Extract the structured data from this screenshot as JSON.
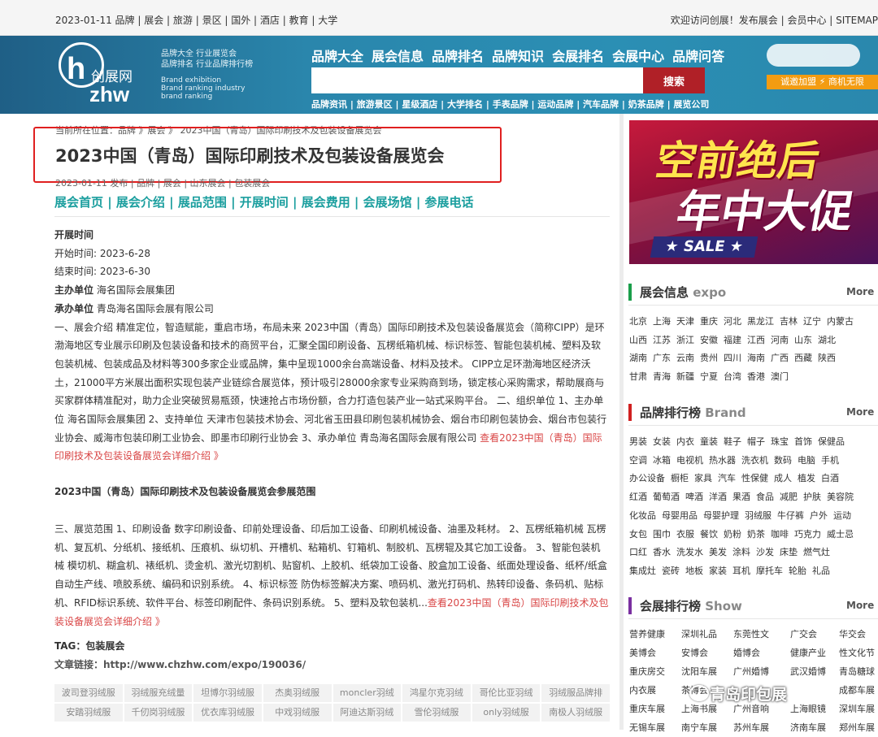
{
  "topbar": {
    "left": "2023-01-11 品牌 | 展会 | 旅游 | 景区 | 国外 | 酒店 | 教育 | 大学",
    "right": "欢迎访问创展！发布展会 | 会员中心 | SITEMAP"
  },
  "header": {
    "logo_cn": "创展网",
    "logo_h": "h",
    "logo_en": "zhw",
    "slogan_1": "品牌大全 行业展览会",
    "slogan_2": "品牌排名 行业品牌排行榜",
    "slogan_en_1": "Brand exhibition",
    "slogan_en_2": "Brand ranking industry",
    "slogan_en_3": "brand ranking",
    "nav": [
      "品牌大全",
      "展会信息",
      "品牌排名",
      "品牌知识",
      "会展排名",
      "会展中心",
      "品牌问答"
    ],
    "search_placeholder": "",
    "search_button": "搜索",
    "subnav": "品牌资讯 | 旅游景区 | 星级酒店 | 大学排名 | 手表品牌 | 运动品牌 | 汽车品牌 | 奶茶品牌 | 展览公司",
    "chip": "诚邀加盟 ⚡ 商机无限"
  },
  "article": {
    "breadcrumb": "当前所在位置：品牌 》展会 》 2023中国（青岛）国际印刷技术及包装设备展览会",
    "title": "2023中国（青岛）国际印刷技术及包装设备展览会",
    "meta": "2023-01-11 发布 | 品牌 | 展会 | 山东展会 | 包装展会",
    "nav": "展会首页 | 展会介绍 | 展品范围 | 开展时间 | 展会费用 | 会展场馆 | 参展电话",
    "time_heading": "开展时间",
    "start": "开始时间: 2023-6-28",
    "end": "结束时间: 2023-6-30",
    "organizer_label": "主办单位",
    "organizer": "海名国际会展集团",
    "undertaker_label": "承办单位",
    "undertaker": "青岛海名国际会展有限公司",
    "intro_1": "一、展会介绍 精准定位，智造赋能，重启市场，布局未来 2023中国（青岛）国际印刷技术及包装设备展览会（简称CIPP）是环渤海地区专业展示印刷及包装设备和技术的商贸平台，汇聚全国印刷设备、瓦楞纸箱机械、标识标签、智能包装机械、塑料及软包装机械、包装成品及材料等300多家企业或品牌，集中呈现1000余台高端设备、材料及技术。 CIPP立足环渤海地区经济沃土，21000平方米展出面积实现包装产业链综合展览体，预计吸引28000余家专业采购商到场，锁定核心采购需求，帮助展商与买家群体精准配对，助力企业突破贸易瓶颈，快速抢占市场份额，合力打造包装产业一站式采购平台。 二、组织单位 1、主办单位 海名国际会展集团 2、支持单位 天津市包装技术协会、河北省玉田县印刷包装机械协会、烟台市印刷包装协会、烟台市包装行业协会、威海市包装印刷工业协会、即墨市印刷行业协会 3、承办单位 青岛海名国际会展有限公司 ",
    "intro_link": "查看2023中国（青岛）国际印刷技术及包装设备展览会详细介绍 》",
    "scope_title": "2023中国（青岛）国际印刷技术及包装设备展览会参展范围",
    "scope_text": "三、展览范围 1、印刷设备 数字印刷设备、印前处理设备、印后加工设备、印刷机械设备、油墨及耗材。 2、瓦楞纸箱机械 瓦楞机、复瓦机、分纸机、接纸机、压痕机、纵切机、开槽机、粘箱机、钉箱机、制胶机、瓦楞辊及其它加工设备。 3、智能包装机械 模切机、糊盒机、裱纸机、烫金机、激光切割机、贴窗机、上胶机、纸袋加工设备、胶盒加工设备、纸面处理设备、纸杯/纸盒自动生产线、喷胶系统、编码和识别系统。 4、标识标签 防伪标签解决方案、喷码机、激光打码机、热转印设备、条码机、贴标机、RFID标识系统、软件平台、标签印刷配件、条码识别系统。 5、塑料及软包装机...",
    "scope_link": "查看2023中国（青岛）国际印刷技术及包装设备展览会详细介绍 》",
    "tag_label": "TAG：",
    "tag_value": "包装展会",
    "link_label": "文章链接：",
    "link_value": "http://www.chzhw.com/expo/190036/",
    "tags": [
      "波司登羽绒服",
      "羽绒服充绒量",
      "坦博尔羽绒服",
      "杰奥羽绒服",
      "moncler羽绒",
      "鸿星尔克羽绒",
      "哥伦比亚羽绒",
      "羽绒服品牌排",
      "安踏羽绒服",
      "千仞岗羽绒服",
      "优衣库羽绒服",
      "中戏羽绒服",
      "阿迪达斯羽绒",
      "雪伦羽绒服",
      "only羽绒服",
      "南极人羽绒服"
    ]
  },
  "sidebar": {
    "banner_line1": "空前绝后",
    "banner_line2": "年中大促",
    "banner_sale": "★ SALE ★",
    "more": "More",
    "expo": {
      "title": "展会信息",
      "en": "expo",
      "rows": [
        [
          "北京",
          "上海",
          "天津",
          "重庆",
          "河北",
          "黑龙江",
          "吉林",
          "辽宁",
          "内蒙古"
        ],
        [
          "山西",
          "江苏",
          "浙江",
          "安徽",
          "福建",
          "江西",
          "河南",
          "山东",
          "湖北"
        ],
        [
          "湖南",
          "广东",
          "云南",
          "贵州",
          "四川",
          "海南",
          "广西",
          "西藏",
          "陕西"
        ],
        [
          "甘肃",
          "青海",
          "新疆",
          "宁夏",
          "台湾",
          "香港",
          "澳门"
        ]
      ]
    },
    "brand": {
      "title": "品牌排行榜",
      "en": "Brand",
      "rows": [
        [
          "男装",
          "女装",
          "内衣",
          "童装",
          "鞋子",
          "帽子",
          "珠宝",
          "首饰",
          "保健品"
        ],
        [
          "空调",
          "冰箱",
          "电视机",
          "热水器",
          "洗衣机",
          "数码",
          "电脑",
          "手机"
        ],
        [
          "办公设备",
          "橱柜",
          "家具",
          "汽车",
          "性保健",
          "成人",
          "植发",
          "白酒"
        ],
        [
          "红酒",
          "葡萄酒",
          "啤酒",
          "洋酒",
          "果酒",
          "食品",
          "减肥",
          "护肤",
          "美容院"
        ],
        [
          "化妆品",
          "母婴用品",
          "母婴护理",
          "羽绒服",
          "牛仔裤",
          "户外",
          "运动"
        ],
        [
          "女包",
          "围巾",
          "衣服",
          "餐饮",
          "奶粉",
          "奶茶",
          "咖啡",
          "巧克力",
          "威士忌"
        ],
        [
          "口红",
          "香水",
          "洗发水",
          "美发",
          "涂料",
          "沙发",
          "床垫",
          "燃气灶"
        ],
        [
          "集成灶",
          "瓷砖",
          "地板",
          "家装",
          "耳机",
          "摩托车",
          "轮胎",
          "礼品"
        ]
      ]
    },
    "show": {
      "title": "会展排行榜",
      "en": "Show",
      "items": [
        "营养健康",
        "深圳礼品",
        "东莞性文",
        "广交会",
        "华交会",
        "美博会",
        "安博会",
        "婚博会",
        "健康产业",
        "性文化节",
        "重庆房交",
        "沈阳车展",
        "广州婚博",
        "武汉婚博",
        "青岛糖球",
        "内衣展",
        "茶博会",
        "",
        "",
        "成都车展",
        "重庆车展",
        "上海书展",
        "广州音响",
        "上海眼镜",
        "深圳车展",
        "无锡车展",
        "南宁车展",
        "苏州车展",
        "济南车展",
        "郑州车展"
      ]
    }
  },
  "watermark": "青岛印包展"
}
